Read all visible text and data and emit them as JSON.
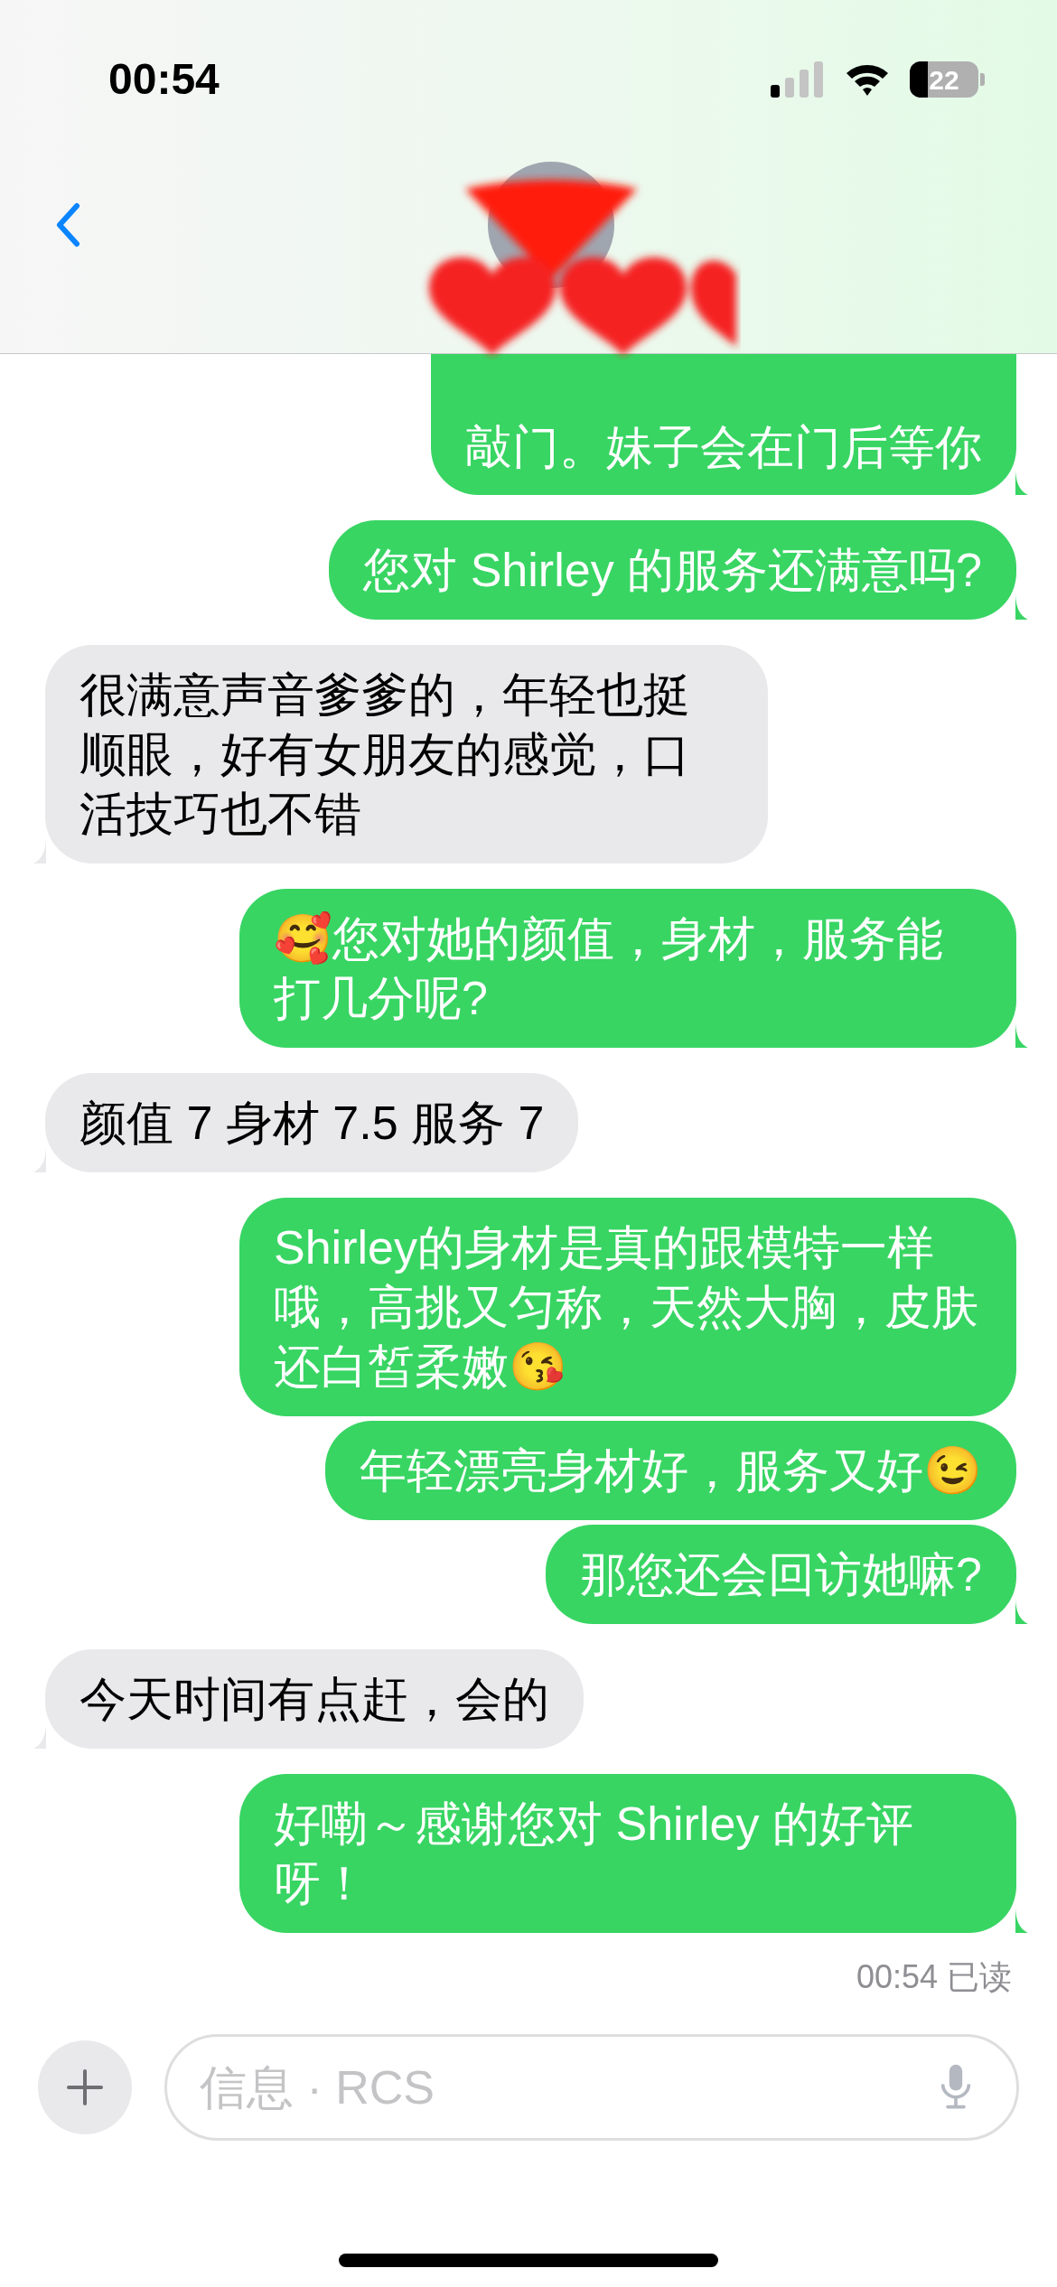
{
  "status_bar": {
    "time": "00:54",
    "battery": "22"
  },
  "messages": [
    {
      "kind": "sent",
      "clipped": true,
      "tail": true,
      "text": "敲门。妹子会在门后等你"
    },
    {
      "kind": "sent",
      "clipped": false,
      "tail": true,
      "text": "您对 Shirley 的服务还满意吗?"
    },
    {
      "kind": "received",
      "clipped": false,
      "tail": true,
      "text": "很满意声音爹爹的，年轻也挺顺眼，好有女朋友的感觉，口活技巧也不错"
    },
    {
      "kind": "sent",
      "clipped": false,
      "tail": true,
      "text": "🥰您对她的颜值，身材，服务能打几分呢?"
    },
    {
      "kind": "received",
      "clipped": false,
      "tail": true,
      "text": "颜值 7 身材 7.5 服务 7"
    },
    {
      "kind": "sent",
      "clipped": false,
      "tail": false,
      "text": "Shirley的身材是真的跟模特一样哦，高挑又匀称，天然大胸，皮肤还白皙柔嫩😘"
    },
    {
      "kind": "sent",
      "clipped": false,
      "tail": false,
      "text": "年轻漂亮身材好，服务又好😉"
    },
    {
      "kind": "sent",
      "clipped": false,
      "tail": true,
      "text": "那您还会回访她嘛?"
    },
    {
      "kind": "received",
      "clipped": false,
      "tail": true,
      "text": "今天时间有点赶，会的"
    },
    {
      "kind": "sent",
      "clipped": false,
      "tail": true,
      "text": "好嘞～感谢您对 Shirley 的好评呀！"
    }
  ],
  "read_receipt": "00:54 已读",
  "composer": {
    "placeholder": "信息 · RCS"
  }
}
